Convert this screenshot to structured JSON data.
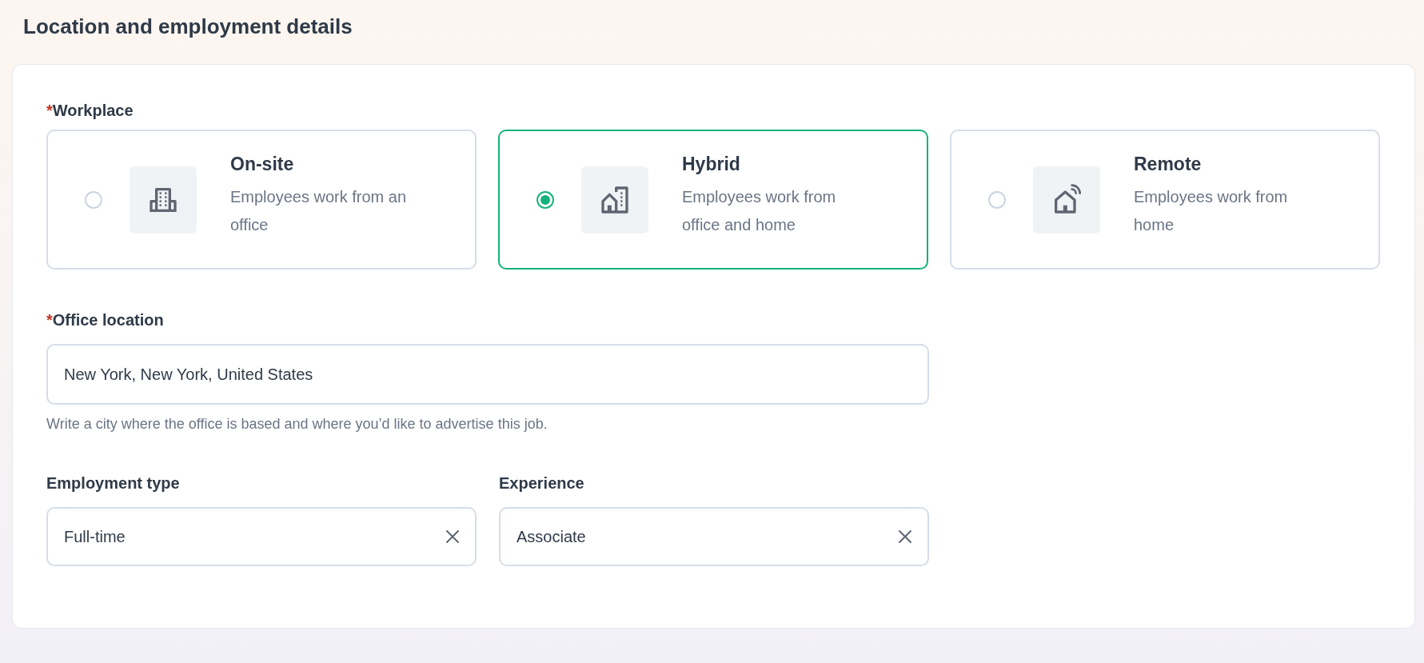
{
  "section": {
    "title": "Location and employment details"
  },
  "workplace": {
    "label": "Workplace",
    "required_mark": "*",
    "options": [
      {
        "title": "On-site",
        "description": "Employees work from an office",
        "selected": false,
        "kind": "building"
      },
      {
        "title": "Hybrid",
        "description": "Employees work from office and home",
        "selected": true,
        "kind": "hybrid"
      },
      {
        "title": "Remote",
        "description": "Employees work from home",
        "selected": false,
        "kind": "remote"
      }
    ]
  },
  "office_location": {
    "label": "Office location",
    "required_mark": "*",
    "value": "New York, New York, United States",
    "help": "Write a city where the office is based and where you’d like to advertise this job."
  },
  "selects": [
    {
      "label": "Employment type",
      "value": "Full-time"
    },
    {
      "label": "Experience",
      "value": "Associate"
    }
  ]
}
